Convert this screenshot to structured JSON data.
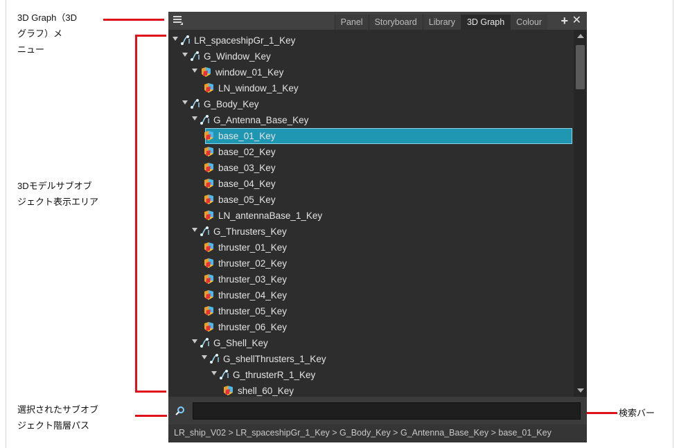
{
  "annotations": {
    "menu_label": "3D Graph（3D\nグラフ）メ\nニュー",
    "display_area_label": "3Dモデルサブオブ\nジェクト表示エリア",
    "path_label": "選択されたサブオブ\nジェクト階層パス",
    "search_label": "検索バー"
  },
  "tabs": [
    {
      "label": "Panel"
    },
    {
      "label": "Storyboard"
    },
    {
      "label": "Library"
    },
    {
      "label": "3D Graph",
      "active": true
    },
    {
      "label": "Colour"
    }
  ],
  "tab_add_label": "+",
  "tab_close_label": "✕",
  "tree": [
    {
      "label": "LR_spaceshipGr_1_Key",
      "type": "group",
      "depth": 0,
      "expanded": true
    },
    {
      "label": "G_Window_Key",
      "type": "group",
      "depth": 1,
      "expanded": true
    },
    {
      "label": "window_01_Key",
      "type": "mesh",
      "depth": 2,
      "expanded": true
    },
    {
      "label": "LN_window_1_Key",
      "type": "mesh",
      "depth": 3
    },
    {
      "label": "G_Body_Key",
      "type": "group",
      "depth": 1,
      "expanded": true
    },
    {
      "label": "G_Antenna_Base_Key",
      "type": "group",
      "depth": 2,
      "expanded": true
    },
    {
      "label": "base_01_Key",
      "type": "mesh",
      "depth": 3,
      "selected": true
    },
    {
      "label": "base_02_Key",
      "type": "mesh",
      "depth": 3
    },
    {
      "label": "base_03_Key",
      "type": "mesh",
      "depth": 3
    },
    {
      "label": "base_04_Key",
      "type": "mesh",
      "depth": 3
    },
    {
      "label": "base_05_Key",
      "type": "mesh",
      "depth": 3
    },
    {
      "label": "LN_antennaBase_1_Key",
      "type": "mesh",
      "depth": 3
    },
    {
      "label": "G_Thrusters_Key",
      "type": "group",
      "depth": 2,
      "expanded": true
    },
    {
      "label": "thruster_01_Key",
      "type": "mesh",
      "depth": 3
    },
    {
      "label": "thruster_02_Key",
      "type": "mesh",
      "depth": 3
    },
    {
      "label": "thruster_03_Key",
      "type": "mesh",
      "depth": 3
    },
    {
      "label": "thruster_04_Key",
      "type": "mesh",
      "depth": 3
    },
    {
      "label": "thruster_05_Key",
      "type": "mesh",
      "depth": 3
    },
    {
      "label": "thruster_06_Key",
      "type": "mesh",
      "depth": 3
    },
    {
      "label": "G_Shell_Key",
      "type": "group",
      "depth": 2,
      "expanded": true
    },
    {
      "label": "G_shellThrusters_1_Key",
      "type": "group",
      "depth": 3,
      "expanded": true
    },
    {
      "label": "G_thrusterR_1_Key",
      "type": "group",
      "depth": 4,
      "expanded": true
    },
    {
      "label": "shell_60_Key",
      "type": "mesh",
      "depth": 5
    }
  ],
  "search": {
    "value": "",
    "placeholder": "",
    "icon": "search-icon"
  },
  "path": "LR_ship_V02 > LR_spaceshipGr_1_Key > G_Body_Key > G_Antenna_Base_Key > base_01_Key",
  "colors": {
    "panel_bg": "#2d2d2d",
    "selection": "#1f97b2",
    "annotation_line": "#e0101a"
  }
}
